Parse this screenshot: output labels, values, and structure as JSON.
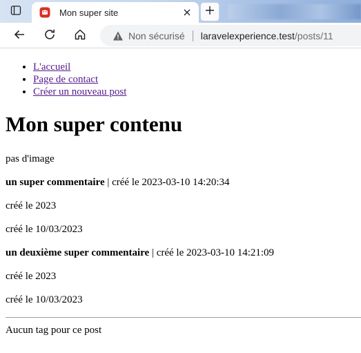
{
  "browser": {
    "tab_title": "Mon super site",
    "security_label": "Non sécurisé",
    "url_host": "laravelexperience.test",
    "url_path": "/posts/11"
  },
  "nav": {
    "items": [
      {
        "label": "L'accueil"
      },
      {
        "label": "Page de contact"
      },
      {
        "label": "Créer un nouveau post"
      }
    ]
  },
  "post": {
    "title": "Mon super contenu",
    "image_text": "pas d'image",
    "comments": [
      {
        "author": "un super commentaire",
        "meta": " | créé le 2023-03-10 14:20:34",
        "year_line": "créé le 2023",
        "date_line": "créé le 10/03/2023"
      },
      {
        "author": "un deuxième super commentaire",
        "meta": " | créé le 2023-03-10 14:21:09",
        "year_line": "créé le 2023",
        "date_line": "créé le 10/03/2023"
      }
    ],
    "tags_text": "Aucun tag pour ce post"
  },
  "colors": {
    "link_visited": "#551a8b",
    "favicon_red": "#d93025",
    "omnibox_bg": "#f1f3f4"
  }
}
